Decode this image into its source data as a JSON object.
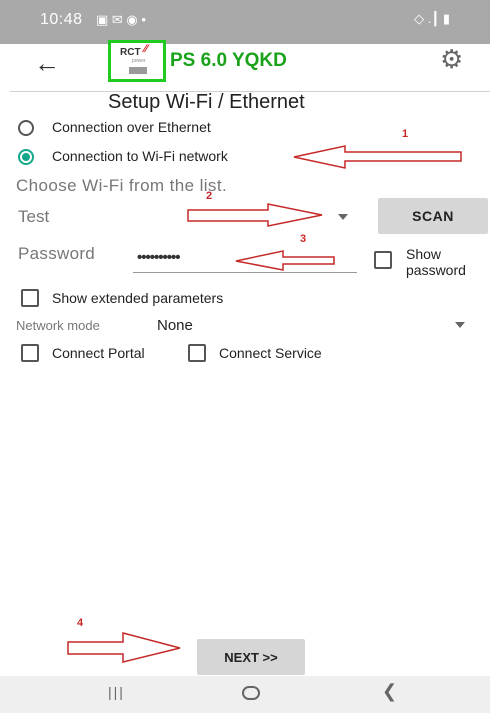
{
  "status_bar": {
    "time": "10:48",
    "left_icons": "▣ ✉ ◉ •",
    "right_icons": "◇ .┃ ▮"
  },
  "app_bar": {
    "title": "PS 6.0 YQKD",
    "logo_text": "RCT",
    "logo_sub": "power",
    "back_icon": "arrow-left-icon",
    "settings_icon": "gear-icon"
  },
  "page": {
    "heading": "Setup Wi-Fi / Ethernet"
  },
  "connection": {
    "option_ethernet": "Connection over Ethernet",
    "option_wifi": "Connection to Wi-Fi network",
    "selected": "wifi"
  },
  "wifi": {
    "hint": "Choose Wi-Fi from the list.",
    "selected_network": "Test",
    "scan_label": "SCAN"
  },
  "password": {
    "label": "Password",
    "masked_value": "••••••••••",
    "show_label_line1": "Show",
    "show_label_line2": "password"
  },
  "extended": {
    "label": "Show extended parameters"
  },
  "network_mode": {
    "label": "Network mode",
    "value": "None"
  },
  "connect": {
    "portal_label": "Connect Portal",
    "service_label": "Connect Service"
  },
  "footer": {
    "next_label": "NEXT >>"
  },
  "annotations": {
    "n1": "1",
    "n2": "2",
    "n3": "3",
    "n4": "4",
    "color": "#c62828"
  },
  "colors": {
    "accent": "#13a88a",
    "title_green": "#1aa31a",
    "logo_border": "#1ecb1e"
  }
}
